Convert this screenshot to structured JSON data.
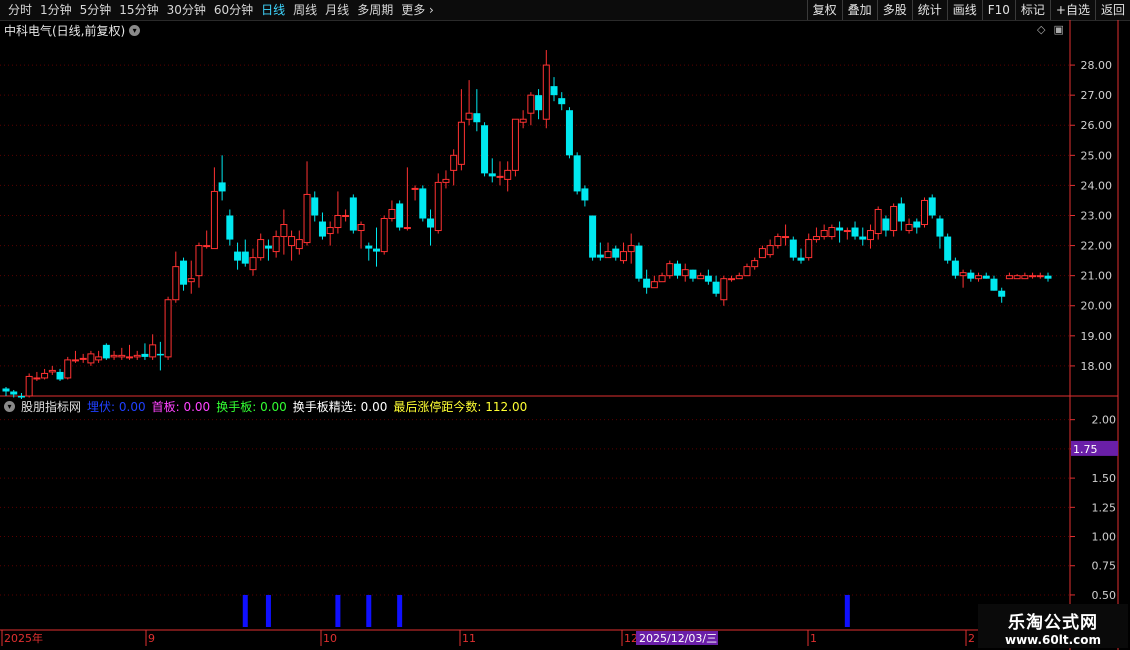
{
  "toolbar": {
    "periods": [
      "分时",
      "1分钟",
      "5分钟",
      "15分钟",
      "30分钟",
      "60分钟",
      "日线",
      "周线",
      "月线",
      "多周期",
      "更多"
    ],
    "active_period": "日线",
    "tools": [
      "复权",
      "叠加",
      "多股",
      "统计",
      "画线",
      "F10",
      "标记",
      "+自选",
      "返回"
    ]
  },
  "stock": {
    "title": "中科电气(日线,前复权)"
  },
  "price_axis": {
    "labels": [
      "28.00",
      "27.00",
      "26.00",
      "25.00",
      "24.00",
      "23.00",
      "22.00",
      "21.00",
      "20.00",
      "19.00",
      "18.00"
    ]
  },
  "indicator": {
    "name": "股朋指标网",
    "items": [
      {
        "label": "埋伏:",
        "value": "0.00",
        "color": "#2040ff"
      },
      {
        "label": "首板:",
        "value": "0.00",
        "color": "#ff44ff"
      },
      {
        "label": "换手板:",
        "value": "0.00",
        "color": "#33ff33"
      },
      {
        "label": "换手板精选:",
        "value": "0.00",
        "color": "#ffffff"
      },
      {
        "label": "最后涨停距今数:",
        "value": "112.00",
        "color": "#ffff33"
      }
    ],
    "axis_labels": [
      "2.00",
      "1.75",
      "1.50",
      "1.25",
      "1.00",
      "0.75",
      "0.50"
    ],
    "cursor_value": "1.75"
  },
  "time_axis": {
    "labels": [
      "2025年",
      "9",
      "10",
      "11",
      "12",
      "1",
      "2"
    ],
    "cursor_date": "2025/12/03/三"
  },
  "watermark": {
    "line1": "乐淘公式网",
    "line2": "www.60lt.com"
  },
  "colors": {
    "up": "#ff3232",
    "down": "#00e8f0",
    "grid": "#5a0000",
    "axis": "#e03030",
    "bar": "#1010ff"
  },
  "chart_data": {
    "type": "candlestick",
    "x": [
      "2025年",
      "9",
      "10",
      "11",
      "12",
      "1",
      "2"
    ],
    "ylim": [
      17.0,
      28.9
    ],
    "candles": [
      [
        17.25,
        17.15,
        17.3,
        17.0
      ],
      [
        17.15,
        17.05,
        17.2,
        16.95
      ],
      [
        17.0,
        16.95,
        17.1,
        16.9
      ],
      [
        17.0,
        17.65,
        17.75,
        16.95
      ],
      [
        17.6,
        17.6,
        17.8,
        17.5
      ],
      [
        17.6,
        17.75,
        17.9,
        17.55
      ],
      [
        17.8,
        17.85,
        18.0,
        17.7
      ],
      [
        17.8,
        17.55,
        17.9,
        17.5
      ],
      [
        17.6,
        18.2,
        18.3,
        17.55
      ],
      [
        18.2,
        18.2,
        18.5,
        18.1
      ],
      [
        18.25,
        18.25,
        18.4,
        18.1
      ],
      [
        18.1,
        18.4,
        18.5,
        18.0
      ],
      [
        18.2,
        18.3,
        18.5,
        18.1
      ],
      [
        18.7,
        18.25,
        18.75,
        18.2
      ],
      [
        18.3,
        18.35,
        18.5,
        18.2
      ],
      [
        18.3,
        18.35,
        18.6,
        18.2
      ],
      [
        18.3,
        18.3,
        18.7,
        18.2
      ],
      [
        18.3,
        18.35,
        18.5,
        18.2
      ],
      [
        18.4,
        18.3,
        18.75,
        18.2
      ],
      [
        18.3,
        18.7,
        19.05,
        18.2
      ],
      [
        18.4,
        18.35,
        18.8,
        17.85
      ],
      [
        18.3,
        20.2,
        20.3,
        18.2
      ],
      [
        20.2,
        21.3,
        21.8,
        20.1
      ],
      [
        21.5,
        20.7,
        21.6,
        20.5
      ],
      [
        20.8,
        20.9,
        21.5,
        20.4
      ],
      [
        21.0,
        22.0,
        22.1,
        20.6
      ],
      [
        22.0,
        22.0,
        22.5,
        21.9
      ],
      [
        21.9,
        23.8,
        24.6,
        21.9
      ],
      [
        24.1,
        23.8,
        25.0,
        23.5
      ],
      [
        23.0,
        22.2,
        23.2,
        22.0
      ],
      [
        21.8,
        21.5,
        22.1,
        21.2
      ],
      [
        21.8,
        21.4,
        22.2,
        21.3
      ],
      [
        21.2,
        21.6,
        21.9,
        21.0
      ],
      [
        21.6,
        22.2,
        22.4,
        21.5
      ],
      [
        22.0,
        21.9,
        22.2,
        21.5
      ],
      [
        21.8,
        22.3,
        22.5,
        21.6
      ],
      [
        22.3,
        22.7,
        23.2,
        21.7
      ],
      [
        22.0,
        22.3,
        22.5,
        21.5
      ],
      [
        21.9,
        22.2,
        22.5,
        21.7
      ],
      [
        22.1,
        23.7,
        24.8,
        22.0
      ],
      [
        23.6,
        23.0,
        23.8,
        22.8
      ],
      [
        22.8,
        22.3,
        23.1,
        22.2
      ],
      [
        22.4,
        22.6,
        22.8,
        22.0
      ],
      [
        22.6,
        23.0,
        23.8,
        22.4
      ],
      [
        23.0,
        23.0,
        23.2,
        22.8
      ],
      [
        23.6,
        22.5,
        23.7,
        22.4
      ],
      [
        22.5,
        22.7,
        22.8,
        21.9
      ],
      [
        22.0,
        21.9,
        22.1,
        21.5
      ],
      [
        21.9,
        21.8,
        22.6,
        21.3
      ],
      [
        21.8,
        22.9,
        23.0,
        21.7
      ],
      [
        22.9,
        23.2,
        23.5,
        22.8
      ],
      [
        23.4,
        22.6,
        23.5,
        22.5
      ],
      [
        22.6,
        22.6,
        24.6,
        22.5
      ],
      [
        23.9,
        23.9,
        24.0,
        23.5
      ],
      [
        23.9,
        22.9,
        24.0,
        22.8
      ],
      [
        22.9,
        22.6,
        23.2,
        22.0
      ],
      [
        22.5,
        24.1,
        24.4,
        22.4
      ],
      [
        24.1,
        24.2,
        24.5,
        23.9
      ],
      [
        24.5,
        25.0,
        25.2,
        24.0
      ],
      [
        24.7,
        26.1,
        27.2,
        24.5
      ],
      [
        26.2,
        26.4,
        27.5,
        26.0
      ],
      [
        26.4,
        26.1,
        27.2,
        25.8
      ],
      [
        26.0,
        24.4,
        26.1,
        24.3
      ],
      [
        24.4,
        24.3,
        24.9,
        24.1
      ],
      [
        24.3,
        24.3,
        24.8,
        24.0
      ],
      [
        24.2,
        24.5,
        24.8,
        23.8
      ],
      [
        24.5,
        26.2,
        26.2,
        24.3
      ],
      [
        26.1,
        26.2,
        26.5,
        25.9
      ],
      [
        26.4,
        27.0,
        27.1,
        26.0
      ],
      [
        27.0,
        26.5,
        27.2,
        26.2
      ],
      [
        26.2,
        28.0,
        28.5,
        25.9
      ],
      [
        27.3,
        27.0,
        27.6,
        26.8
      ],
      [
        26.9,
        26.7,
        27.1,
        26.5
      ],
      [
        26.5,
        25.0,
        26.6,
        24.9
      ],
      [
        25.0,
        23.8,
        25.1,
        23.7
      ],
      [
        23.9,
        23.5,
        24.0,
        23.3
      ],
      [
        23.0,
        21.6,
        23.0,
        21.5
      ],
      [
        21.7,
        21.6,
        22.1,
        21.5
      ],
      [
        21.6,
        21.8,
        22.1,
        21.6
      ],
      [
        21.9,
        21.6,
        22.0,
        21.5
      ],
      [
        21.5,
        21.8,
        22.1,
        21.4
      ],
      [
        21.8,
        22.0,
        22.4,
        21.4
      ],
      [
        22.0,
        20.9,
        22.1,
        20.8
      ],
      [
        20.9,
        20.6,
        21.2,
        20.4
      ],
      [
        20.6,
        20.8,
        21.0,
        20.6
      ],
      [
        20.8,
        21.0,
        21.1,
        20.8
      ],
      [
        21.0,
        21.4,
        21.5,
        20.9
      ],
      [
        21.4,
        21.0,
        21.5,
        20.9
      ],
      [
        21.0,
        21.2,
        21.4,
        20.8
      ],
      [
        21.2,
        20.9,
        21.2,
        20.8
      ],
      [
        20.9,
        21.0,
        21.1,
        20.9
      ],
      [
        21.0,
        20.8,
        21.2,
        20.7
      ],
      [
        20.8,
        20.4,
        21.0,
        20.3
      ],
      [
        20.2,
        20.9,
        21.0,
        20.0
      ],
      [
        20.9,
        20.9,
        21.0,
        20.8
      ],
      [
        20.9,
        21.0,
        21.1,
        20.9
      ],
      [
        21.0,
        21.3,
        21.4,
        21.0
      ],
      [
        21.3,
        21.5,
        21.6,
        21.2
      ],
      [
        21.6,
        21.9,
        22.0,
        21.6
      ],
      [
        21.7,
        22.0,
        22.2,
        21.6
      ],
      [
        22.0,
        22.3,
        22.4,
        21.9
      ],
      [
        22.3,
        22.3,
        22.7,
        22.0
      ],
      [
        22.2,
        21.6,
        22.3,
        21.5
      ],
      [
        21.6,
        21.5,
        21.9,
        21.4
      ],
      [
        21.6,
        22.2,
        22.4,
        21.5
      ],
      [
        22.2,
        22.3,
        22.6,
        22.1
      ],
      [
        22.3,
        22.5,
        22.7,
        22.2
      ],
      [
        22.3,
        22.6,
        22.7,
        22.2
      ],
      [
        22.6,
        22.5,
        22.8,
        22.1
      ],
      [
        22.5,
        22.5,
        22.6,
        22.2
      ],
      [
        22.6,
        22.3,
        22.8,
        22.2
      ],
      [
        22.3,
        22.2,
        22.6,
        22.0
      ],
      [
        22.2,
        22.5,
        22.7,
        21.9
      ],
      [
        22.4,
        23.2,
        23.3,
        22.2
      ],
      [
        22.9,
        22.5,
        23.0,
        22.3
      ],
      [
        22.5,
        23.3,
        23.4,
        22.3
      ],
      [
        23.4,
        22.8,
        23.6,
        22.5
      ],
      [
        22.5,
        22.7,
        22.9,
        22.4
      ],
      [
        22.8,
        22.6,
        22.9,
        22.4
      ],
      [
        22.7,
        23.5,
        23.6,
        22.6
      ],
      [
        23.6,
        23.0,
        23.7,
        22.9
      ],
      [
        22.9,
        22.3,
        23.0,
        21.9
      ],
      [
        22.3,
        21.5,
        22.4,
        21.4
      ],
      [
        21.5,
        21.0,
        21.6,
        20.9
      ],
      [
        21.0,
        21.1,
        21.2,
        20.6
      ],
      [
        21.1,
        20.9,
        21.2,
        20.8
      ],
      [
        20.9,
        21.0,
        21.1,
        20.8
      ],
      [
        21.0,
        20.9,
        21.1,
        20.9
      ],
      [
        20.9,
        20.5,
        21.0,
        20.5
      ],
      [
        20.5,
        20.3,
        20.6,
        20.1
      ],
      [
        20.9,
        21.0,
        21.1,
        20.9
      ],
      [
        20.9,
        21.0,
        21.05,
        20.9
      ],
      [
        20.9,
        21.0,
        21.1,
        20.9
      ],
      [
        21.0,
        21.0,
        21.1,
        20.9
      ],
      [
        21.0,
        21.0,
        21.1,
        20.9
      ],
      [
        21.0,
        20.9,
        21.1,
        20.8
      ]
    ],
    "indicator_bars": [
      {
        "index": 31,
        "value": 0.5
      },
      {
        "index": 34,
        "value": 0.5
      },
      {
        "index": 43,
        "value": 0.5
      },
      {
        "index": 47,
        "value": 0.5
      },
      {
        "index": 51,
        "value": 0.5
      },
      {
        "index": 109,
        "value": 0.5
      }
    ],
    "indicator_ylim": [
      0.2,
      2.1
    ]
  }
}
